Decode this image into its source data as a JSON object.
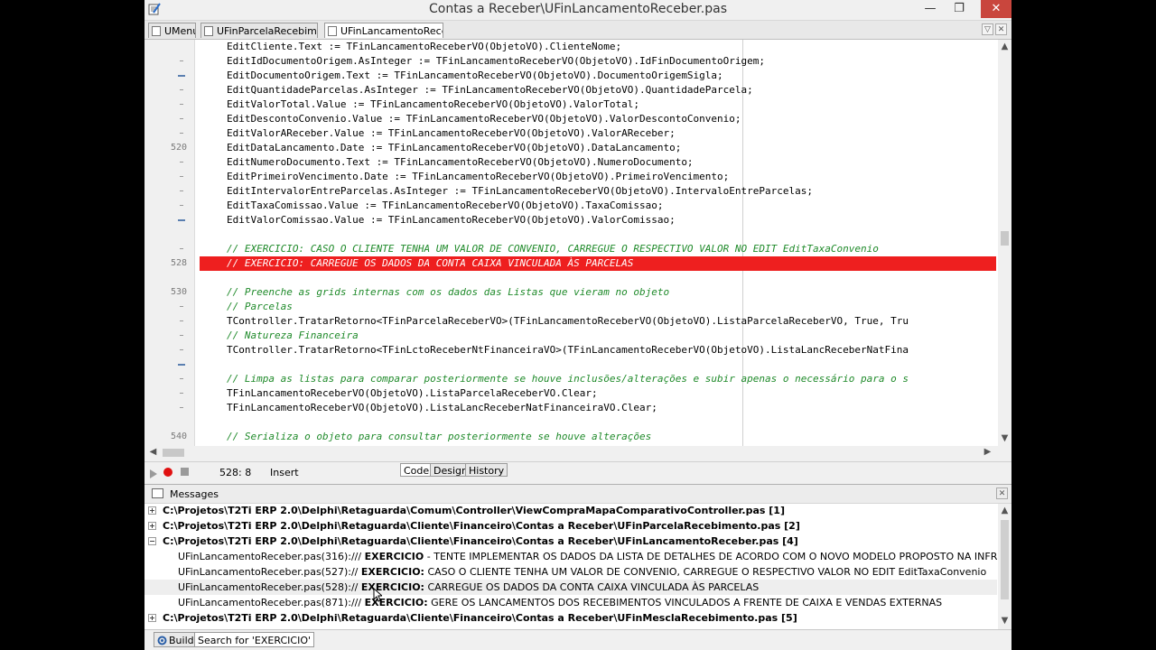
{
  "window": {
    "title": "Contas a Receber\\UFinLancamentoReceber.pas",
    "minimize": "—",
    "restore": "❐",
    "close": "✕"
  },
  "tabs": [
    {
      "label": "UMenu"
    },
    {
      "label": "UFinParcelaRecebimento"
    },
    {
      "label": "UFinLancamentoReceber"
    }
  ],
  "tab_buttons": {
    "dropdown": "▽",
    "close": "✕"
  },
  "gutter": {
    "numbers": [
      "520",
      "528",
      "530",
      "540"
    ]
  },
  "code": {
    "lines": [
      "EditCliente.Text := TFinLancamentoReceberVO(ObjetoVO).ClienteNome;",
      "EditIdDocumentoOrigem.AsInteger := TFinLancamentoReceberVO(ObjetoVO).IdFinDocumentoOrigem;",
      "EditDocumentoOrigem.Text := TFinLancamentoReceberVO(ObjetoVO).DocumentoOrigemSigla;",
      "EditQuantidadeParcelas.AsInteger := TFinLancamentoReceberVO(ObjetoVO).QuantidadeParcela;",
      "EditValorTotal.Value := TFinLancamentoReceberVO(ObjetoVO).ValorTotal;",
      "EditDescontoConvenio.Value := TFinLancamentoReceberVO(ObjetoVO).ValorDescontoConvenio;",
      "EditValorAReceber.Value := TFinLancamentoReceberVO(ObjetoVO).ValorAReceber;",
      "EditDataLancamento.Date := TFinLancamentoReceberVO(ObjetoVO).DataLancamento;",
      "EditNumeroDocumento.Text := TFinLancamentoReceberVO(ObjetoVO).NumeroDocumento;",
      "EditPrimeiroVencimento.Date := TFinLancamentoReceberVO(ObjetoVO).PrimeiroVencimento;",
      "EditIntervalorEntreParcelas.AsInteger := TFinLancamentoReceberVO(ObjetoVO).IntervaloEntreParcelas;",
      "EditTaxaComissao.Value := TFinLancamentoReceberVO(ObjetoVO).TaxaComissao;",
      "EditValorComissao.Value := TFinLancamentoReceberVO(ObjetoVO).ValorComissao;",
      "",
      "// EXERCICIO: CASO O CLIENTE TENHA UM VALOR DE CONVENIO, CARREGUE O RESPECTIVO VALOR NO EDIT EditTaxaConvenio",
      "// EXERCICIO: CARREGUE OS DADOS DA CONTA CAIXA VINCULADA ÀS PARCELAS",
      "",
      "// Preenche as grids internas com os dados das Listas que vieram no objeto",
      "// Parcelas",
      "TController.TratarRetorno<TFinParcelaReceberVO>(TFinLancamentoReceberVO(ObjetoVO).ListaParcelaReceberVO, True, Tru",
      "// Natureza Financeira",
      "TController.TratarRetorno<TFinLctoReceberNtFinanceiraVO>(TFinLancamentoReceberVO(ObjetoVO).ListaLancReceberNatFina",
      "",
      "// Limpa as listas para comparar posteriormente se houve inclusões/alterações e subir apenas o necessário para o s",
      "TFinLancamentoReceberVO(ObjetoVO).ListaParcelaReceberVO.Clear;",
      "TFinLancamentoReceberVO(ObjetoVO).ListaLancReceberNatFinanceiraVO.Clear;",
      "",
      "// Serializa o objeto para consultar posteriormente se houve alterações"
    ]
  },
  "status": {
    "position": "528:  8",
    "mode": "Insert",
    "views": [
      "Code",
      "Design",
      "History"
    ]
  },
  "messages": {
    "title": "Messages",
    "rows": [
      {
        "kind": "file",
        "expander": "+",
        "text": "C:\\Projetos\\T2Ti ERP 2.0\\Delphi\\Retaguarda\\Comum\\Controller\\ViewCompraMapaComparativoController.pas [1]"
      },
      {
        "kind": "file",
        "expander": "+",
        "text": "C:\\Projetos\\T2Ti ERP 2.0\\Delphi\\Retaguarda\\Cliente\\Financeiro\\Contas a Receber\\UFinParcelaRecebimento.pas [2]"
      },
      {
        "kind": "file",
        "expander": "−",
        "text": "C:\\Projetos\\T2Ti ERP 2.0\\Delphi\\Retaguarda\\Cliente\\Financeiro\\Contas a Receber\\UFinLancamentoReceber.pas [4]"
      },
      {
        "kind": "item",
        "ref": "UFinLancamentoReceber.pas(316):",
        "prefix": "/// ",
        "keyword": "EXERCICIO",
        "rest": " - TENTE IMPLEMENTAR OS DADOS DA LISTA DE DETALHES DE ACORDO COM O NOVO MODELO PROPOSTO NA INFRA"
      },
      {
        "kind": "item",
        "ref": "UFinLancamentoReceber.pas(527):",
        "prefix": "// ",
        "keyword": "EXERCICIO:",
        "rest": " CASO O CLIENTE TENHA UM VALOR DE CONVENIO, CARREGUE O RESPECTIVO VALOR NO EDIT EditTaxaConvenio"
      },
      {
        "kind": "item",
        "ref": "UFinLancamentoReceber.pas(528):",
        "prefix": "// ",
        "keyword": "EXERCICIO:",
        "rest": " CARREGUE OS DADOS DA CONTA CAIXA VINCULADA ÀS PARCELAS"
      },
      {
        "kind": "item",
        "ref": "UFinLancamentoReceber.pas(871):",
        "prefix": "/// ",
        "keyword": "EXERCICIO:",
        "rest": " GERE OS LANCAMENTOS DOS RECEBIMENTOS VINCULADOS A FRENTE DE CAIXA E VENDAS EXTERNAS"
      },
      {
        "kind": "file",
        "expander": "+",
        "text": "C:\\Projetos\\T2Ti ERP 2.0\\Delphi\\Retaguarda\\Cliente\\Financeiro\\Contas a Receber\\UFinMesclaRecebimento.pas [5]"
      }
    ]
  },
  "bottom_tabs": [
    "Build",
    "Search for 'EXERCICIO'"
  ],
  "colors": {
    "highlight_line": "#ee1f1f",
    "comment": "#1f8a2a",
    "breakpoint": "#e01010"
  }
}
